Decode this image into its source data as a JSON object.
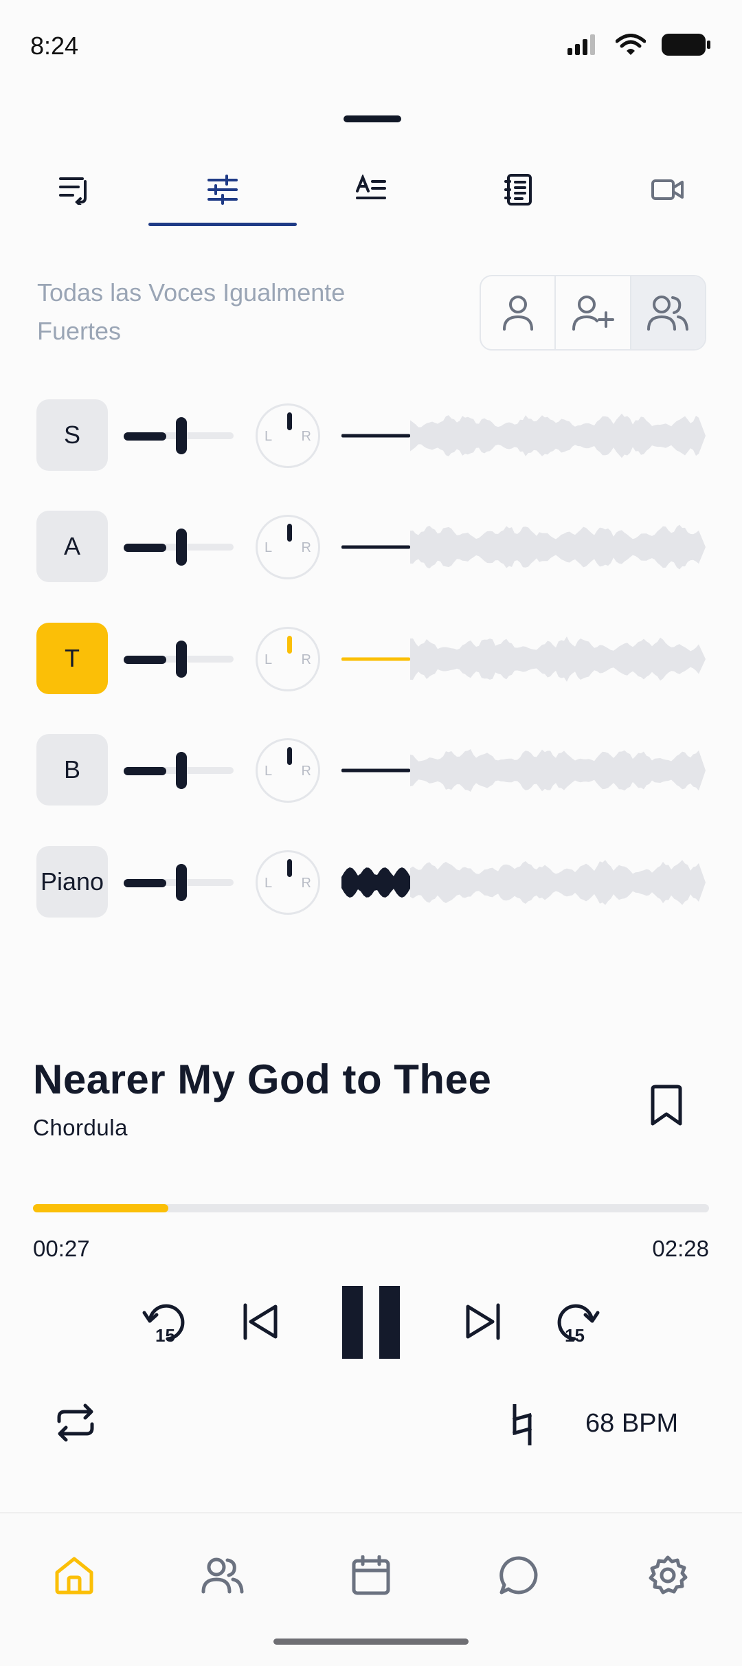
{
  "status_bar": {
    "time": "8:24",
    "icons": [
      "signal-icon",
      "wifi-icon",
      "battery-icon"
    ]
  },
  "tabs": [
    {
      "name": "queue",
      "icon": "queue-list-icon",
      "active": false
    },
    {
      "name": "mixer",
      "icon": "sliders-icon",
      "active": true
    },
    {
      "name": "lyrics",
      "icon": "lyrics-icon",
      "active": false
    },
    {
      "name": "sheet",
      "icon": "sheet-music-icon",
      "active": false
    },
    {
      "name": "video",
      "icon": "video-icon",
      "active": false
    }
  ],
  "balance": {
    "label": "Todas las Voces Igualmente Fuertes",
    "options": [
      {
        "icon": "user-icon",
        "selected": false
      },
      {
        "icon": "user-plus-icon",
        "selected": false
      },
      {
        "icon": "users-icon",
        "selected": true
      }
    ]
  },
  "voices": [
    {
      "label": "S",
      "active": false,
      "volume": 0.55,
      "pan_l": "L",
      "pan_r": "R"
    },
    {
      "label": "A",
      "active": false,
      "volume": 0.55,
      "pan_l": "L",
      "pan_r": "R"
    },
    {
      "label": "T",
      "active": true,
      "volume": 0.55,
      "pan_l": "L",
      "pan_r": "R"
    },
    {
      "label": "B",
      "active": false,
      "volume": 0.55,
      "pan_l": "L",
      "pan_r": "R"
    },
    {
      "label": "Piano",
      "active": false,
      "volume": 0.55,
      "pan_l": "L",
      "pan_r": "R"
    }
  ],
  "song": {
    "title": "Nearer My God to Thee",
    "artist": "Chordula"
  },
  "playback": {
    "elapsed": "00:27",
    "total": "02:28",
    "progress": 0.2
  },
  "controls": {
    "back_label": "15",
    "forward_label": "15",
    "bpm": "68 BPM"
  },
  "colors": {
    "accent": "#fbbf07",
    "dark": "#141a2b",
    "tab_active": "#1f3b86",
    "muted": "#9aa5b5"
  },
  "bottom_nav": [
    {
      "icon": "home-icon",
      "active": true
    },
    {
      "icon": "users-icon",
      "active": false
    },
    {
      "icon": "calendar-icon",
      "active": false
    },
    {
      "icon": "chat-icon",
      "active": false
    },
    {
      "icon": "settings-icon",
      "active": false
    }
  ]
}
